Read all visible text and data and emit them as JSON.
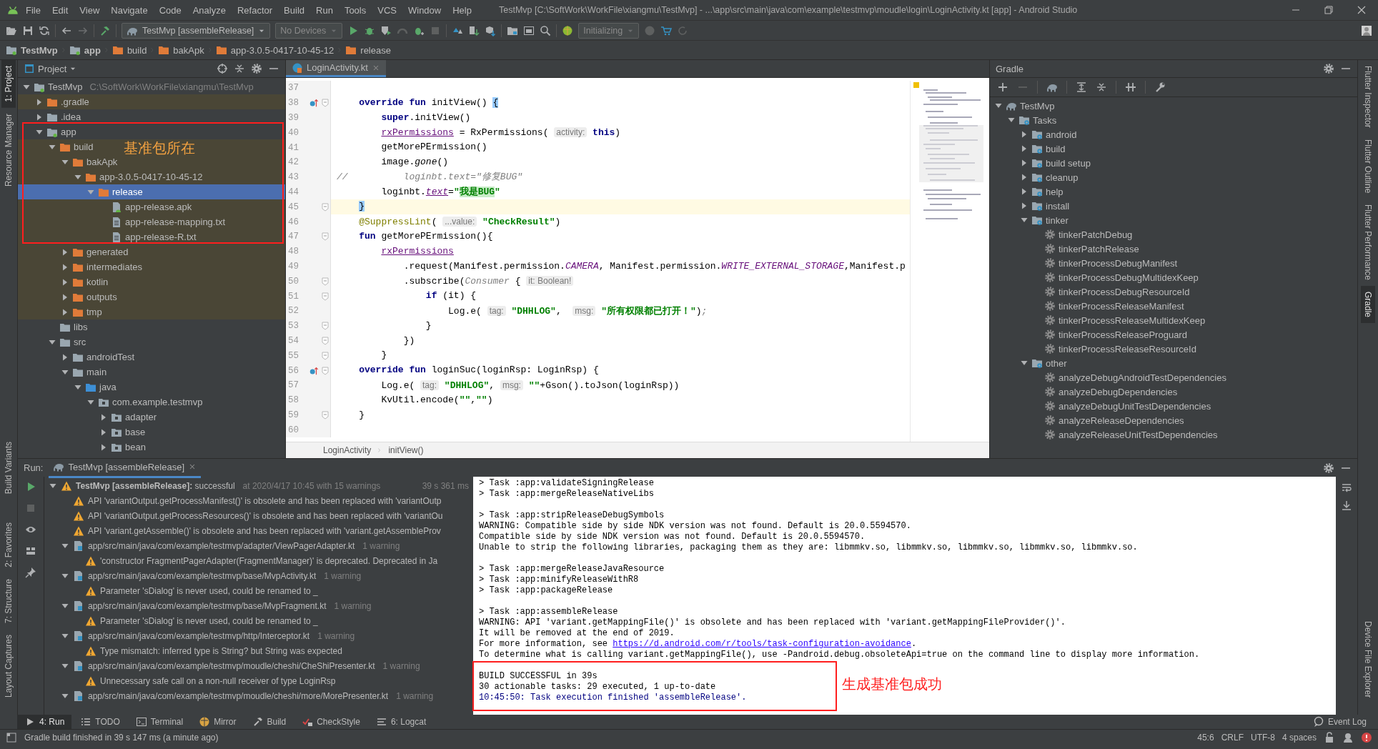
{
  "window": {
    "title": "TestMvp [C:\\SoftWork\\WorkFile\\xiangmu\\TestMvp] - ...\\app\\src\\main\\java\\com\\example\\testmvp\\moudle\\login\\LoginActivity.kt [app] - Android Studio",
    "menu": [
      "File",
      "Edit",
      "View",
      "Navigate",
      "Code",
      "Analyze",
      "Refactor",
      "Build",
      "Run",
      "Tools",
      "VCS",
      "Window",
      "Help"
    ]
  },
  "toolbar": {
    "run_config": "TestMvp [assembleRelease]",
    "device": "No Devices",
    "status": "Initializing"
  },
  "breadcrumb": [
    {
      "text": "TestMvp",
      "kind": "module"
    },
    {
      "text": "app",
      "kind": "module"
    },
    {
      "text": "build",
      "kind": "folder"
    },
    {
      "text": "bakApk",
      "kind": "folder"
    },
    {
      "text": "app-3.0.5-0417-10-45-12",
      "kind": "folder"
    },
    {
      "text": "release",
      "kind": "folder"
    }
  ],
  "left_stripe": {
    "top_group": [
      {
        "label": "1: Project",
        "selected": true
      },
      {
        "label": "Resource Manager",
        "selected": false
      }
    ],
    "middle_group": [
      {
        "label": "Build Variants",
        "selected": false
      }
    ],
    "bottom_group": [
      {
        "label": "2: Favorites",
        "selected": false
      },
      {
        "label": "7: Structure",
        "selected": false
      },
      {
        "label": "Layout Captures",
        "selected": false
      }
    ]
  },
  "project": {
    "title": "Project",
    "annotation": "基准包所在",
    "tree": [
      {
        "text": "TestMvp",
        "note": "C:\\SoftWork\\WorkFile\\xiangmu\\TestMvp",
        "kind": "module",
        "expanded": true,
        "selected": false,
        "excluded": false,
        "children": [
          {
            "text": ".gradle",
            "kind": "folder-excluded",
            "expanded": false,
            "selected": false,
            "excluded": true
          },
          {
            "text": ".idea",
            "kind": "folder",
            "expanded": false,
            "selected": false,
            "excluded": false
          },
          {
            "text": "app",
            "kind": "module",
            "expanded": true,
            "selected": false,
            "excluded": false,
            "children": [
              {
                "text": "build",
                "kind": "folder-excluded",
                "expanded": true,
                "selected": false,
                "excluded": true,
                "children": [
                  {
                    "text": "bakApk",
                    "kind": "folder-excluded",
                    "expanded": true,
                    "selected": false,
                    "excluded": true,
                    "children": [
                      {
                        "text": "app-3.0.5-0417-10-45-12",
                        "kind": "folder-excluded",
                        "expanded": true,
                        "selected": false,
                        "excluded": true,
                        "children": [
                          {
                            "text": "release",
                            "kind": "folder-excluded",
                            "expanded": true,
                            "selected": true,
                            "excluded": true,
                            "children": [
                              {
                                "text": "app-release.apk",
                                "kind": "apk",
                                "selected": false,
                                "excluded": true
                              },
                              {
                                "text": "app-release-mapping.txt",
                                "kind": "file",
                                "selected": false,
                                "excluded": true
                              },
                              {
                                "text": "app-release-R.txt",
                                "kind": "file",
                                "selected": false,
                                "excluded": true
                              }
                            ]
                          }
                        ]
                      }
                    ]
                  },
                  {
                    "text": "generated",
                    "kind": "folder-excluded",
                    "expanded": false,
                    "selected": false,
                    "excluded": true
                  },
                  {
                    "text": "intermediates",
                    "kind": "folder-excluded",
                    "expanded": false,
                    "selected": false,
                    "excluded": true
                  },
                  {
                    "text": "kotlin",
                    "kind": "folder-excluded",
                    "expanded": false,
                    "selected": false,
                    "excluded": true
                  },
                  {
                    "text": "outputs",
                    "kind": "folder-excluded",
                    "expanded": false,
                    "selected": false,
                    "excluded": true
                  },
                  {
                    "text": "tmp",
                    "kind": "folder-excluded",
                    "expanded": false,
                    "selected": false,
                    "excluded": true
                  }
                ]
              },
              {
                "text": "libs",
                "kind": "folder",
                "selected": false,
                "excluded": false
              },
              {
                "text": "src",
                "kind": "folder",
                "expanded": true,
                "selected": false,
                "excluded": false,
                "children": [
                  {
                    "text": "androidTest",
                    "kind": "folder",
                    "expanded": false,
                    "selected": false,
                    "excluded": false
                  },
                  {
                    "text": "main",
                    "kind": "folder",
                    "expanded": true,
                    "selected": false,
                    "excluded": false,
                    "children": [
                      {
                        "text": "java",
                        "kind": "folder-source",
                        "expanded": true,
                        "selected": false,
                        "excluded": false,
                        "children": [
                          {
                            "text": "com.example.testmvp",
                            "kind": "package",
                            "expanded": true,
                            "selected": false,
                            "excluded": false,
                            "children": [
                              {
                                "text": "adapter",
                                "kind": "package",
                                "expanded": false,
                                "selected": false,
                                "excluded": false
                              },
                              {
                                "text": "base",
                                "kind": "package",
                                "expanded": false,
                                "selected": false,
                                "excluded": false
                              },
                              {
                                "text": "bean",
                                "kind": "package",
                                "expanded": false,
                                "selected": false,
                                "excluded": false
                              }
                            ]
                          }
                        ]
                      }
                    ]
                  }
                ]
              }
            ]
          }
        ]
      }
    ]
  },
  "editor": {
    "tab": "LoginActivity.kt",
    "footer_path": [
      "LoginActivity",
      "initView()"
    ],
    "lines": [
      {
        "number": "37",
        "current": false,
        "fold": false,
        "override_marker": false
      },
      {
        "number": "38",
        "current": false,
        "fold": true,
        "override_marker": true,
        "tokens": [
          {
            "kind": "kw",
            "text": "    override fun "
          },
          {
            "kind": "plain",
            "text": "initView() "
          },
          {
            "kind": "brace",
            "text": "{"
          }
        ]
      },
      {
        "number": "39",
        "current": false,
        "fold": false,
        "override_marker": false,
        "tokens": [
          {
            "kind": "kw",
            "text": "        super"
          },
          {
            "kind": "plain",
            "text": ".initView()"
          }
        ]
      },
      {
        "number": "40",
        "current": false,
        "fold": false,
        "override_marker": false,
        "tokens": [
          {
            "kind": "field",
            "text": "        rxPermissions"
          },
          {
            "kind": "plain",
            "text": " = RxPermissions( "
          },
          {
            "kind": "hint",
            "text": "activity:"
          },
          {
            "kind": "kw",
            "text": " this"
          },
          {
            "kind": "plain",
            "text": ")"
          }
        ]
      },
      {
        "number": "41",
        "current": false,
        "fold": false,
        "override_marker": false,
        "tokens": [
          {
            "kind": "plain",
            "text": "        getMorePErmission()"
          }
        ]
      },
      {
        "number": "42",
        "current": false,
        "fold": false,
        "override_marker": false,
        "tokens": [
          {
            "kind": "plain",
            "text": "        image."
          },
          {
            "kind": "italic",
            "text": "gone"
          },
          {
            "kind": "plain",
            "text": "()"
          }
        ]
      },
      {
        "number": "43",
        "current": false,
        "fold": false,
        "override_marker": false,
        "tokens": [
          {
            "kind": "comment",
            "text": "//          loginbt.text=\"修复BUG\""
          }
        ]
      },
      {
        "number": "44",
        "current": false,
        "fold": false,
        "override_marker": false,
        "tokens": [
          {
            "kind": "plain",
            "text": "        loginbt."
          },
          {
            "kind": "fieldi",
            "text": "text"
          },
          {
            "kind": "plain",
            "text": "="
          },
          {
            "kind": "str",
            "text": "\""
          },
          {
            "kind": "strhl",
            "text": "我是BUG"
          },
          {
            "kind": "str",
            "text": "\""
          }
        ]
      },
      {
        "number": "45",
        "current": true,
        "fold": true,
        "override_marker": false,
        "tokens": [
          {
            "kind": "brace",
            "text": "    }"
          }
        ]
      },
      {
        "number": "46",
        "current": false,
        "fold": false,
        "override_marker": false,
        "tokens": [
          {
            "kind": "annot",
            "text": "    @SuppressLint"
          },
          {
            "kind": "plain",
            "text": "( "
          },
          {
            "kind": "hint",
            "text": "...value:"
          },
          {
            "kind": "str",
            "text": " \"CheckResult\""
          },
          {
            "kind": "plain",
            "text": ")"
          }
        ]
      },
      {
        "number": "47",
        "current": false,
        "fold": true,
        "override_marker": false,
        "tokens": [
          {
            "kind": "kw",
            "text": "    fun "
          },
          {
            "kind": "plain",
            "text": "getMorePErmission(){"
          }
        ]
      },
      {
        "number": "48",
        "current": false,
        "fold": false,
        "override_marker": false,
        "tokens": [
          {
            "kind": "field",
            "text": "        rxPermissions"
          }
        ]
      },
      {
        "number": "49",
        "current": false,
        "fold": false,
        "override_marker": false,
        "tokens": [
          {
            "kind": "plain",
            "text": "            .request(Manifest.permission."
          },
          {
            "kind": "const",
            "text": "CAMERA"
          },
          {
            "kind": "plain",
            "text": ", Manifest.permission."
          },
          {
            "kind": "const",
            "text": "WRITE_EXTERNAL_STORAGE"
          },
          {
            "kind": "plain",
            "text": ",Manifest.p"
          }
        ]
      },
      {
        "number": "50",
        "current": false,
        "fold": true,
        "override_marker": false,
        "tokens": [
          {
            "kind": "plain",
            "text": "            .subscribe("
          },
          {
            "kind": "gray",
            "text": "Consumer"
          },
          {
            "kind": "plain",
            "text": " { "
          },
          {
            "kind": "hint",
            "text": "it: Boolean!"
          }
        ]
      },
      {
        "number": "51",
        "current": false,
        "fold": true,
        "override_marker": false,
        "tokens": [
          {
            "kind": "kw",
            "text": "                if "
          },
          {
            "kind": "plain",
            "text": "(it) {"
          }
        ]
      },
      {
        "number": "52",
        "current": false,
        "fold": false,
        "override_marker": false,
        "tokens": [
          {
            "kind": "plain",
            "text": "                    Log.e( "
          },
          {
            "kind": "hint",
            "text": "tag:"
          },
          {
            "kind": "str",
            "text": " \"DHHLOG\""
          },
          {
            "kind": "plain",
            "text": ",  "
          },
          {
            "kind": "hint",
            "text": "msg:"
          },
          {
            "kind": "str",
            "text": " \"所有权限都已打开！\""
          },
          {
            "kind": "plain",
            "text": ")"
          },
          {
            "kind": "gray",
            "text": ";"
          }
        ]
      },
      {
        "number": "53",
        "current": false,
        "fold": true,
        "override_marker": false,
        "tokens": [
          {
            "kind": "plain",
            "text": "                }"
          }
        ]
      },
      {
        "number": "54",
        "current": false,
        "fold": true,
        "override_marker": false,
        "tokens": [
          {
            "kind": "plain",
            "text": "            })"
          }
        ]
      },
      {
        "number": "55",
        "current": false,
        "fold": true,
        "override_marker": false,
        "tokens": [
          {
            "kind": "plain",
            "text": "        }"
          }
        ]
      },
      {
        "number": "56",
        "current": false,
        "fold": true,
        "override_marker": true,
        "tokens": [
          {
            "kind": "kw",
            "text": "    override fun "
          },
          {
            "kind": "plain",
            "text": "loginSuc(loginRsp: LoginRsp) {"
          }
        ]
      },
      {
        "number": "57",
        "current": false,
        "fold": false,
        "override_marker": false,
        "tokens": [
          {
            "kind": "plain",
            "text": "        Log.e( "
          },
          {
            "kind": "hint",
            "text": "tag:"
          },
          {
            "kind": "str",
            "text": " \"DHHLOG\""
          },
          {
            "kind": "plain",
            "text": ", "
          },
          {
            "kind": "hint",
            "text": "msg:"
          },
          {
            "kind": "str",
            "text": " \"\""
          },
          {
            "kind": "plain",
            "text": "+Gson().toJson(loginRsp))"
          }
        ]
      },
      {
        "number": "58",
        "current": false,
        "fold": false,
        "override_marker": false,
        "tokens": [
          {
            "kind": "plain",
            "text": "        KvUtil.encode("
          },
          {
            "kind": "str",
            "text": "\"\""
          },
          {
            "kind": "plain",
            "text": ","
          },
          {
            "kind": "str",
            "text": "\"\""
          },
          {
            "kind": "plain",
            "text": ")"
          }
        ]
      },
      {
        "number": "59",
        "current": false,
        "fold": true,
        "override_marker": false,
        "tokens": [
          {
            "kind": "plain",
            "text": "    }"
          }
        ]
      },
      {
        "number": "60",
        "current": false,
        "fold": false,
        "override_marker": false
      }
    ]
  },
  "gradle": {
    "title": "Gradle",
    "tree": [
      {
        "text": "TestMvp",
        "kind": "project",
        "expanded": true,
        "children": [
          {
            "text": "Tasks",
            "kind": "task-folder",
            "expanded": true,
            "children": [
              {
                "text": "android",
                "kind": "task-folder",
                "expanded": false
              },
              {
                "text": "build",
                "kind": "task-folder",
                "expanded": false
              },
              {
                "text": "build setup",
                "kind": "task-folder",
                "expanded": false
              },
              {
                "text": "cleanup",
                "kind": "task-folder",
                "expanded": false
              },
              {
                "text": "help",
                "kind": "task-folder",
                "expanded": false
              },
              {
                "text": "install",
                "kind": "task-folder",
                "expanded": false
              },
              {
                "text": "tinker",
                "kind": "task-folder",
                "expanded": true,
                "children": [
                  {
                    "text": "tinkerPatchDebug",
                    "kind": "task"
                  },
                  {
                    "text": "tinkerPatchRelease",
                    "kind": "task"
                  },
                  {
                    "text": "tinkerProcessDebugManifest",
                    "kind": "task"
                  },
                  {
                    "text": "tinkerProcessDebugMultidexKeep",
                    "kind": "task"
                  },
                  {
                    "text": "tinkerProcessDebugResourceId",
                    "kind": "task"
                  },
                  {
                    "text": "tinkerProcessReleaseManifest",
                    "kind": "task"
                  },
                  {
                    "text": "tinkerProcessReleaseMultidexKeep",
                    "kind": "task"
                  },
                  {
                    "text": "tinkerProcessReleaseProguard",
                    "kind": "task"
                  },
                  {
                    "text": "tinkerProcessReleaseResourceId",
                    "kind": "task"
                  }
                ]
              },
              {
                "text": "other",
                "kind": "task-folder",
                "expanded": true,
                "children": [
                  {
                    "text": "analyzeDebugAndroidTestDependencies",
                    "kind": "task"
                  },
                  {
                    "text": "analyzeDebugDependencies",
                    "kind": "task"
                  },
                  {
                    "text": "analyzeDebugUnitTestDependencies",
                    "kind": "task"
                  },
                  {
                    "text": "analyzeReleaseDependencies",
                    "kind": "task"
                  },
                  {
                    "text": "analyzeReleaseUnitTestDependencies",
                    "kind": "task"
                  }
                ]
              }
            ]
          }
        ]
      }
    ]
  },
  "right_stripe": {
    "top_group": [
      {
        "label": "Flutter Inspector",
        "selected": false
      },
      {
        "label": "Flutter Outline",
        "selected": false
      },
      {
        "label": "Flutter Performance",
        "selected": false
      },
      {
        "label": "Gradle",
        "selected": true
      }
    ],
    "bottom_group": [
      {
        "label": "Device File Explorer",
        "selected": false
      }
    ]
  },
  "run": {
    "label": "Run:",
    "tab": "TestMvp [assembleRelease]",
    "tree": [
      {
        "kind": "root",
        "title": "TestMvp [assembleRelease]:",
        "text": "successful",
        "note": "at 2020/4/17 10:45 with 15 warnings",
        "time": "39 s 361 ms",
        "expanded": true,
        "children": [
          {
            "kind": "warning",
            "text": "API 'variantOutput.getProcessManifest()' is obsolete and has been replaced with 'variantOutp"
          },
          {
            "kind": "warning",
            "text": "API 'variantOutput.getProcessResources()' is obsolete and has been replaced with 'variantOu"
          },
          {
            "kind": "warning",
            "text": "API 'variant.getAssemble()' is obsolete and has been replaced with 'variant.getAssembleProv"
          },
          {
            "kind": "file",
            "text": "app/src/main/java/com/example/testmvp/adapter/ViewPagerAdapter.kt",
            "note": "1 warning",
            "expanded": true,
            "children": [
              {
                "kind": "warning",
                "text": "'constructor FragmentPagerAdapter(FragmentManager)' is deprecated. Deprecated in Ja"
              }
            ]
          },
          {
            "kind": "file",
            "text": "app/src/main/java/com/example/testmvp/base/MvpActivity.kt",
            "note": "1 warning",
            "expanded": true,
            "children": [
              {
                "kind": "warning",
                "text": "Parameter 'sDialog' is never used, could be renamed to _"
              }
            ]
          },
          {
            "kind": "file",
            "text": "app/src/main/java/com/example/testmvp/base/MvpFragment.kt",
            "note": "1 warning",
            "expanded": true,
            "children": [
              {
                "kind": "warning",
                "text": "Parameter 'sDialog' is never used, could be renamed to _"
              }
            ]
          },
          {
            "kind": "file",
            "text": "app/src/main/java/com/example/testmvp/http/Interceptor.kt",
            "note": "1 warning",
            "expanded": true,
            "children": [
              {
                "kind": "warning",
                "text": "Type mismatch: inferred type is String? but String was expected"
              }
            ]
          },
          {
            "kind": "file",
            "text": "app/src/main/java/com/example/testmvp/moudle/cheshi/CheShiPresenter.kt",
            "note": "1 warning",
            "expanded": true,
            "children": [
              {
                "kind": "warning",
                "text": "Unnecessary safe call on a non-null receiver of type LoginRsp"
              }
            ]
          },
          {
            "kind": "file",
            "text": "app/src/main/java/com/example/testmvp/moudle/cheshi/more/MorePresenter.kt",
            "note": "1 warning",
            "expanded": true
          }
        ]
      }
    ]
  },
  "console": {
    "annotation": "生成基准包成功",
    "lines": [
      {
        "kind": "plain",
        "text": "> Task :app:validateSigningRelease"
      },
      {
        "kind": "plain",
        "text": "> Task :app:mergeReleaseNativeLibs"
      },
      {
        "kind": "blank"
      },
      {
        "kind": "plain",
        "text": "> Task :app:stripReleaseDebugSymbols"
      },
      {
        "kind": "plain",
        "text": "WARNING: Compatible side by side NDK version was not found. Default is 20.0.5594570."
      },
      {
        "kind": "plain",
        "text": "Compatible side by side NDK version was not found. Default is 20.0.5594570."
      },
      {
        "kind": "plain",
        "text": "Unable to strip the following libraries, packaging them as they are: libmmkv.so, libmmkv.so, libmmkv.so, libmmkv.so, libmmkv.so."
      },
      {
        "kind": "blank"
      },
      {
        "kind": "plain",
        "text": "> Task :app:mergeReleaseJavaResource"
      },
      {
        "kind": "plain",
        "text": "> Task :app:minifyReleaseWithR8"
      },
      {
        "kind": "plain",
        "text": "> Task :app:packageRelease"
      },
      {
        "kind": "blank"
      },
      {
        "kind": "plain",
        "text": "> Task :app:assembleRelease"
      },
      {
        "kind": "plain",
        "text": "WARNING: API 'variant.getMappingFile()' is obsolete and has been replaced with 'variant.getMappingFileProvider()'."
      },
      {
        "kind": "plain",
        "text": "It will be removed at the end of 2019."
      },
      {
        "kind": "link",
        "text": "For more information, see ",
        "link": "https://d.android.com/r/tools/task-configuration-avoidance",
        "after": "."
      },
      {
        "kind": "plain",
        "text": "To determine what is calling variant.getMappingFile(), use -Pandroid.debug.obsoleteApi=true on the command line to display more information."
      },
      {
        "kind": "blank"
      },
      {
        "kind": "plain",
        "text": "BUILD SUCCESSFUL in 39s"
      },
      {
        "kind": "plain",
        "text": "30 actionable tasks: 29 executed, 1 up-to-date"
      },
      {
        "kind": "info",
        "text": "10:45:50: Task execution finished 'assembleRelease'."
      }
    ]
  },
  "tool_tabs": [
    {
      "label": "4: Run",
      "kind": "run",
      "selected": true
    },
    {
      "label": "TODO",
      "kind": "todo",
      "selected": false
    },
    {
      "label": "Terminal",
      "kind": "terminal",
      "selected": false
    },
    {
      "label": "Mirror",
      "kind": "mirror",
      "selected": false
    },
    {
      "label": "Build",
      "kind": "build",
      "selected": false
    },
    {
      "label": "CheckStyle",
      "kind": "checkstyle",
      "selected": false
    },
    {
      "label": "6: Logcat",
      "kind": "logcat",
      "selected": false
    }
  ],
  "event_log": "Event Log",
  "status_bar": {
    "message": "Gradle build finished in 39 s 147 ms (a minute ago)",
    "position": "45:6",
    "line_separator": "CRLF",
    "encoding": "UTF-8",
    "indent": "4 spaces"
  }
}
